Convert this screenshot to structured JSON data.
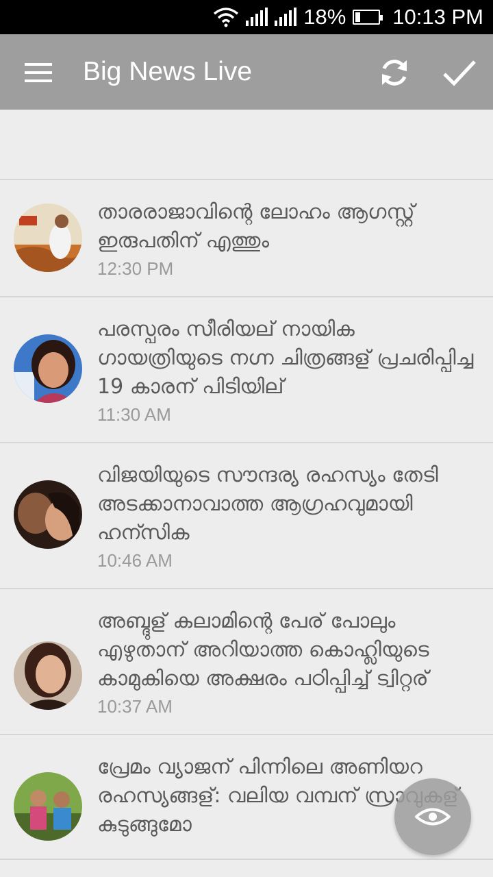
{
  "status_bar": {
    "battery": "18%",
    "time": "10:13 PM"
  },
  "app_bar": {
    "title": "Big News Live",
    "menu_icon": "hamburger-menu-icon",
    "refresh_icon": "refresh-icon",
    "done_icon": "check-icon"
  },
  "colors": {
    "app_bar": "#9e9e9e",
    "background": "#ededed",
    "headline": "#5a5a5a",
    "time": "#9a9a9a"
  },
  "news": [
    {
      "headline": "താരരാജാവിന്റെ ലോഹം ആഗസ്റ്റ് ഇരുപതിന് എത്തും",
      "time": "12:30 PM"
    },
    {
      "headline": "പരസ്പരം സീരിയല് നായിക ഗായത്രിയുടെ നഗ്ന ചിത്രങ്ങള് പ്രചരിപ്പിച്ച 19 കാരന് പിടിയില്",
      "time": "11:30 AM"
    },
    {
      "headline": "വിജയിയുടെ സൗന്ദര്യ രഹസ്യം തേടി അടക്കാനാവാത്ത ആഗ്രഹവുമായി ഹന്സിക",
      "time": "10:46 AM"
    },
    {
      "headline": "അബ്ദുള് കലാമിന്റെ പേര് പോലും എഴുതാന് അറിയാത്ത കൊഹ്ലിയുടെ കാമുകിയെ അക്ഷരം പഠിപ്പിച്ച് ട്വിറ്റര്",
      "time": "10:37 AM"
    },
    {
      "headline": "പ്രേമം വ്യാജന് പിന്നിലെ അണിയറ രഹസ്യങ്ങള്: വലിയ വമ്പന് സ്രാവുകള് കുടുങ്ങുമോ",
      "time": ""
    }
  ],
  "fab": {
    "icon": "eye-icon"
  }
}
